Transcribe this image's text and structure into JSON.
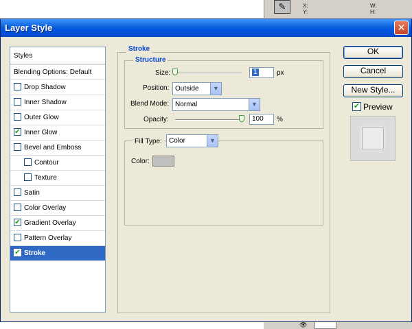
{
  "background_app": {
    "xy_label": "X:\nY:",
    "wh_label": "W:\nH:"
  },
  "dialog": {
    "title": "Layer Style",
    "close_glyph": "✕"
  },
  "styles_list": {
    "header": "Styles",
    "blending": "Blending Options: Default",
    "items": [
      {
        "label": "Drop Shadow",
        "checked": false,
        "sub": false
      },
      {
        "label": "Inner Shadow",
        "checked": false,
        "sub": false
      },
      {
        "label": "Outer Glow",
        "checked": false,
        "sub": false
      },
      {
        "label": "Inner Glow",
        "checked": true,
        "sub": false
      },
      {
        "label": "Bevel and Emboss",
        "checked": false,
        "sub": false
      },
      {
        "label": "Contour",
        "checked": false,
        "sub": true
      },
      {
        "label": "Texture",
        "checked": false,
        "sub": true
      },
      {
        "label": "Satin",
        "checked": false,
        "sub": false
      },
      {
        "label": "Color Overlay",
        "checked": false,
        "sub": false
      },
      {
        "label": "Gradient Overlay",
        "checked": true,
        "sub": false
      },
      {
        "label": "Pattern Overlay",
        "checked": false,
        "sub": false
      },
      {
        "label": "Stroke",
        "checked": true,
        "sub": false,
        "selected": true
      }
    ]
  },
  "stroke": {
    "section_title": "Stroke",
    "structure_title": "Structure",
    "size_label": "Size:",
    "size_value": "1",
    "size_unit": "px",
    "position_label": "Position:",
    "position_value": "Outside",
    "blend_label": "Blend Mode:",
    "blend_value": "Normal",
    "opacity_label": "Opacity:",
    "opacity_value": "100",
    "opacity_unit": "%",
    "fill_type_label": "Fill Type:",
    "fill_type_value": "Color",
    "color_label": "Color:",
    "color_swatch": "#c0c0c0"
  },
  "buttons": {
    "ok": "OK",
    "cancel": "Cancel",
    "new_style": "New Style...",
    "preview": "Preview",
    "preview_checked": true
  },
  "icons": {
    "checkmark": "✔",
    "dropdown": "▼",
    "tool": "✎",
    "eye": "👁"
  }
}
